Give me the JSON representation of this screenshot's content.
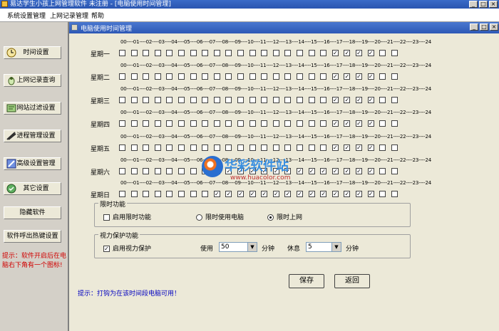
{
  "window": {
    "title": "易达学生小孩上网管理软件 未注册 - [电脑使用时间管理]"
  },
  "menu": {
    "items": [
      "系统设置管理",
      "上网记录管理",
      "帮助"
    ]
  },
  "sidebar": {
    "buttons": [
      {
        "label": "时间设置",
        "icon": "clock-icon"
      },
      {
        "label": "上网记录查询",
        "icon": "search-record-icon"
      },
      {
        "label": "网站过滤设置",
        "icon": "filter-icon"
      },
      {
        "label": "进程管理设置",
        "icon": "process-icon"
      },
      {
        "label": "高级设置管理",
        "icon": "advanced-icon"
      },
      {
        "label": "其它设置",
        "icon": "other-icon"
      },
      {
        "label": "隐藏软件",
        "icon": ""
      },
      {
        "label": "软件呼出热键设置",
        "icon": ""
      }
    ],
    "hint": "提示：软件开启后在电脑右下角有一个图标!"
  },
  "child_window": {
    "title": "电脑使用时间管理"
  },
  "hours_header": "00----01----02----03----04----05----06----07----08----09----10----11----12----13----14----15----16----17----18----19----20----21----22----23----24",
  "days": [
    {
      "name": "星期一",
      "checked": [
        18,
        19,
        20,
        21
      ]
    },
    {
      "name": "星期二",
      "checked": [
        18,
        19,
        20,
        21
      ]
    },
    {
      "name": "星期三",
      "checked": [
        18,
        19,
        20,
        21
      ]
    },
    {
      "name": "星期四",
      "checked": [
        18,
        19,
        20,
        21
      ]
    },
    {
      "name": "星期五",
      "checked": [
        18,
        19,
        20,
        21
      ]
    },
    {
      "name": "星期六",
      "checked": [
        8,
        9,
        10,
        11,
        12,
        13,
        14,
        15,
        16,
        17,
        18,
        19,
        20,
        21
      ]
    },
    {
      "name": "星期日",
      "checked": [
        8,
        9,
        10,
        11,
        12,
        13,
        14,
        15,
        16,
        17,
        18,
        19,
        20,
        21
      ]
    }
  ],
  "time_limit": {
    "group_label": "限时功能",
    "enable_label": "启用限时功能",
    "enable_checked": false,
    "radio_use_pc": "限时使用电脑",
    "radio_internet": "限时上网",
    "selected": "internet"
  },
  "eye_protect": {
    "group_label": "视力保护功能",
    "enable_label": "启用视力保护",
    "enable_checked": true,
    "use_label": "使用",
    "use_value": "50",
    "use_unit": "分钟",
    "rest_label": "休息",
    "rest_value": "5",
    "rest_unit": "分钟"
  },
  "buttons": {
    "save": "保存",
    "back": "返回"
  },
  "footer_hint": "提示：打钩为在该时间段电脑可用！",
  "watermark": {
    "cn": "华彩软件站",
    "url": "www.huacolor.com"
  }
}
